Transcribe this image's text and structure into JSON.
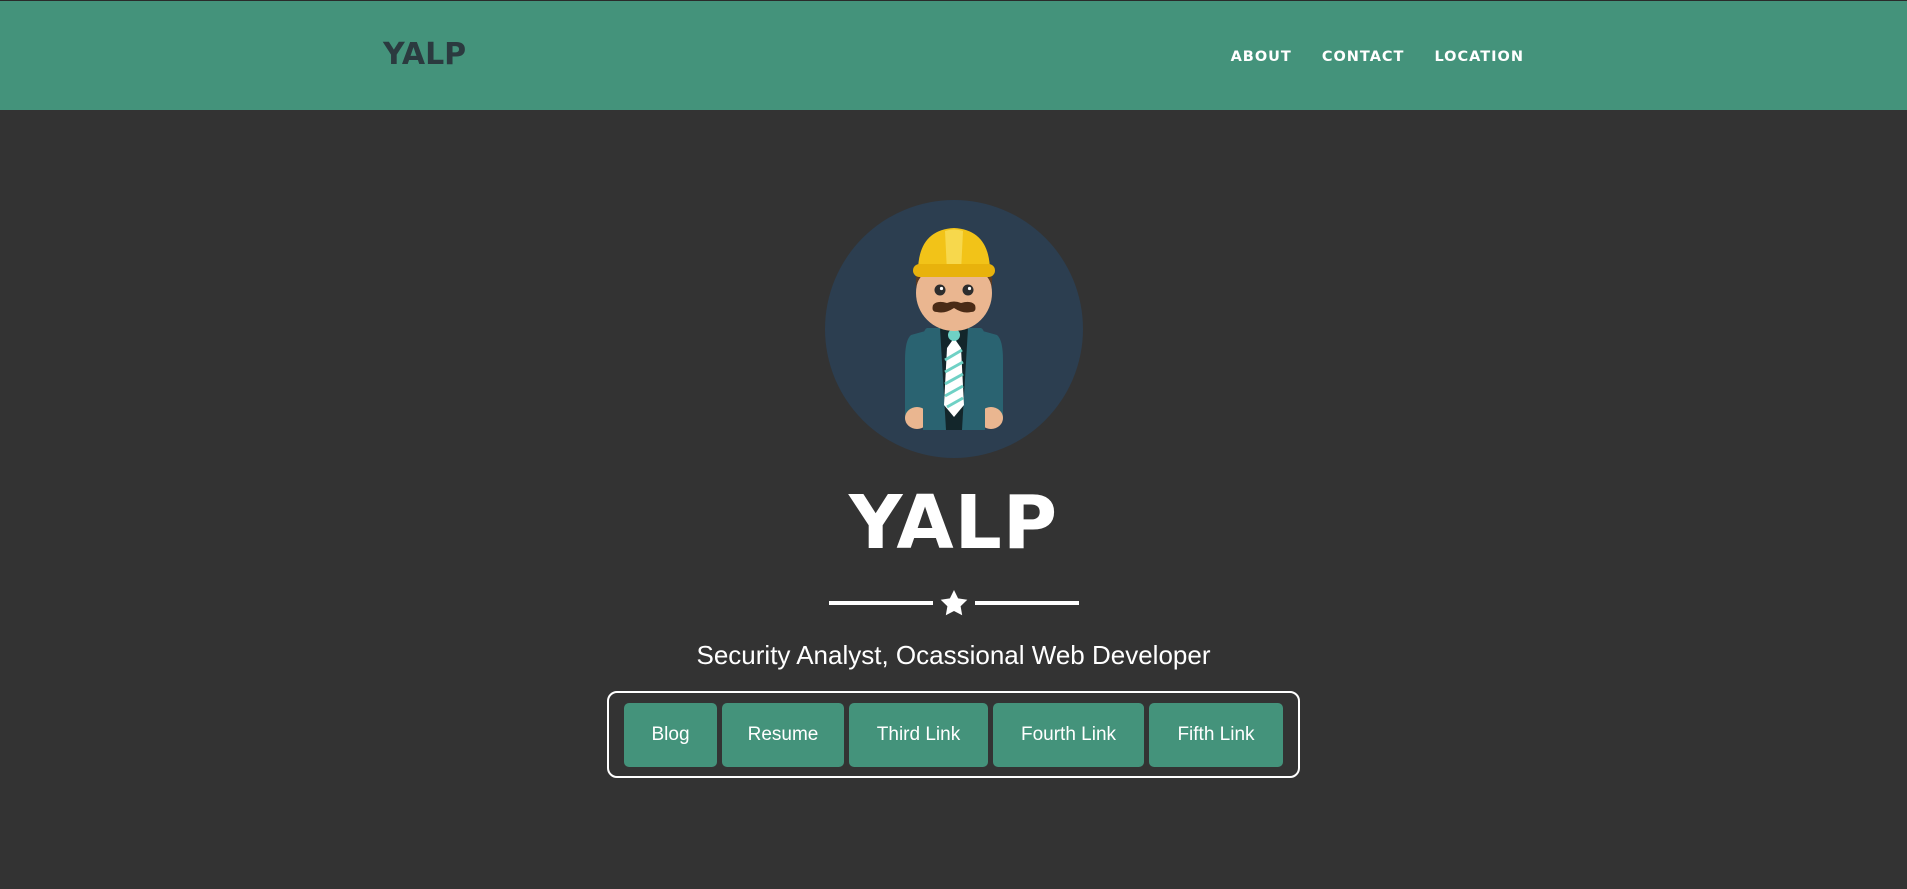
{
  "navbar": {
    "brand": "YALP",
    "links": [
      "ABOUT",
      "CONTACT",
      "LOCATION"
    ]
  },
  "hero": {
    "avatar_icon": "construction-worker-icon",
    "title": "YALP",
    "divider_icon": "star-icon",
    "subtitle": "Security Analyst, Ocassional Web Developer",
    "links": [
      "Blog",
      "Resume",
      "Third Link",
      "Fourth Link",
      "Fifth Link"
    ]
  },
  "colors": {
    "navbar_bg": "#44937b",
    "page_bg": "#333333",
    "avatar_bg": "#2c3e50",
    "button_bg": "#44937b",
    "text": "#ffffff"
  }
}
